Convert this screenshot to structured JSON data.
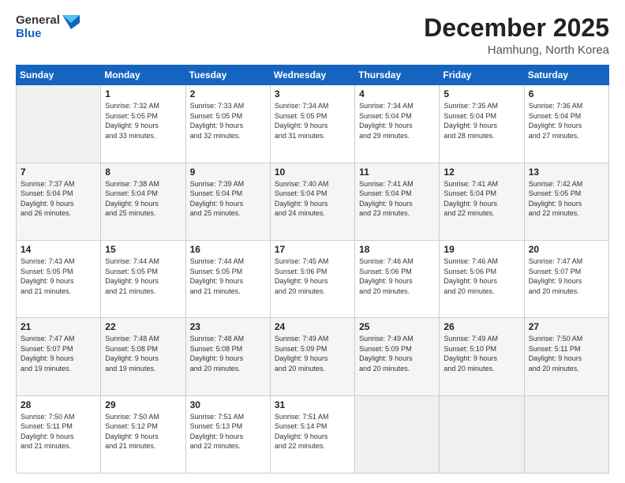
{
  "header": {
    "logo_general": "General",
    "logo_blue": "Blue",
    "month_title": "December 2025",
    "location": "Hamhung, North Korea"
  },
  "weekdays": [
    "Sunday",
    "Monday",
    "Tuesday",
    "Wednesday",
    "Thursday",
    "Friday",
    "Saturday"
  ],
  "weeks": [
    [
      {
        "day": "",
        "info": ""
      },
      {
        "day": "1",
        "info": "Sunrise: 7:32 AM\nSunset: 5:05 PM\nDaylight: 9 hours\nand 33 minutes."
      },
      {
        "day": "2",
        "info": "Sunrise: 7:33 AM\nSunset: 5:05 PM\nDaylight: 9 hours\nand 32 minutes."
      },
      {
        "day": "3",
        "info": "Sunrise: 7:34 AM\nSunset: 5:05 PM\nDaylight: 9 hours\nand 31 minutes."
      },
      {
        "day": "4",
        "info": "Sunrise: 7:34 AM\nSunset: 5:04 PM\nDaylight: 9 hours\nand 29 minutes."
      },
      {
        "day": "5",
        "info": "Sunrise: 7:35 AM\nSunset: 5:04 PM\nDaylight: 9 hours\nand 28 minutes."
      },
      {
        "day": "6",
        "info": "Sunrise: 7:36 AM\nSunset: 5:04 PM\nDaylight: 9 hours\nand 27 minutes."
      }
    ],
    [
      {
        "day": "7",
        "info": "Sunrise: 7:37 AM\nSunset: 5:04 PM\nDaylight: 9 hours\nand 26 minutes."
      },
      {
        "day": "8",
        "info": "Sunrise: 7:38 AM\nSunset: 5:04 PM\nDaylight: 9 hours\nand 25 minutes."
      },
      {
        "day": "9",
        "info": "Sunrise: 7:39 AM\nSunset: 5:04 PM\nDaylight: 9 hours\nand 25 minutes."
      },
      {
        "day": "10",
        "info": "Sunrise: 7:40 AM\nSunset: 5:04 PM\nDaylight: 9 hours\nand 24 minutes."
      },
      {
        "day": "11",
        "info": "Sunrise: 7:41 AM\nSunset: 5:04 PM\nDaylight: 9 hours\nand 23 minutes."
      },
      {
        "day": "12",
        "info": "Sunrise: 7:41 AM\nSunset: 5:04 PM\nDaylight: 9 hours\nand 22 minutes."
      },
      {
        "day": "13",
        "info": "Sunrise: 7:42 AM\nSunset: 5:05 PM\nDaylight: 9 hours\nand 22 minutes."
      }
    ],
    [
      {
        "day": "14",
        "info": "Sunrise: 7:43 AM\nSunset: 5:05 PM\nDaylight: 9 hours\nand 21 minutes."
      },
      {
        "day": "15",
        "info": "Sunrise: 7:44 AM\nSunset: 5:05 PM\nDaylight: 9 hours\nand 21 minutes."
      },
      {
        "day": "16",
        "info": "Sunrise: 7:44 AM\nSunset: 5:05 PM\nDaylight: 9 hours\nand 21 minutes."
      },
      {
        "day": "17",
        "info": "Sunrise: 7:45 AM\nSunset: 5:06 PM\nDaylight: 9 hours\nand 20 minutes."
      },
      {
        "day": "18",
        "info": "Sunrise: 7:46 AM\nSunset: 5:06 PM\nDaylight: 9 hours\nand 20 minutes."
      },
      {
        "day": "19",
        "info": "Sunrise: 7:46 AM\nSunset: 5:06 PM\nDaylight: 9 hours\nand 20 minutes."
      },
      {
        "day": "20",
        "info": "Sunrise: 7:47 AM\nSunset: 5:07 PM\nDaylight: 9 hours\nand 20 minutes."
      }
    ],
    [
      {
        "day": "21",
        "info": "Sunrise: 7:47 AM\nSunset: 5:07 PM\nDaylight: 9 hours\nand 19 minutes."
      },
      {
        "day": "22",
        "info": "Sunrise: 7:48 AM\nSunset: 5:08 PM\nDaylight: 9 hours\nand 19 minutes."
      },
      {
        "day": "23",
        "info": "Sunrise: 7:48 AM\nSunset: 5:08 PM\nDaylight: 9 hours\nand 20 minutes."
      },
      {
        "day": "24",
        "info": "Sunrise: 7:49 AM\nSunset: 5:09 PM\nDaylight: 9 hours\nand 20 minutes."
      },
      {
        "day": "25",
        "info": "Sunrise: 7:49 AM\nSunset: 5:09 PM\nDaylight: 9 hours\nand 20 minutes."
      },
      {
        "day": "26",
        "info": "Sunrise: 7:49 AM\nSunset: 5:10 PM\nDaylight: 9 hours\nand 20 minutes."
      },
      {
        "day": "27",
        "info": "Sunrise: 7:50 AM\nSunset: 5:11 PM\nDaylight: 9 hours\nand 20 minutes."
      }
    ],
    [
      {
        "day": "28",
        "info": "Sunrise: 7:50 AM\nSunset: 5:11 PM\nDaylight: 9 hours\nand 21 minutes."
      },
      {
        "day": "29",
        "info": "Sunrise: 7:50 AM\nSunset: 5:12 PM\nDaylight: 9 hours\nand 21 minutes."
      },
      {
        "day": "30",
        "info": "Sunrise: 7:51 AM\nSunset: 5:13 PM\nDaylight: 9 hours\nand 22 minutes."
      },
      {
        "day": "31",
        "info": "Sunrise: 7:51 AM\nSunset: 5:14 PM\nDaylight: 9 hours\nand 22 minutes."
      },
      {
        "day": "",
        "info": ""
      },
      {
        "day": "",
        "info": ""
      },
      {
        "day": "",
        "info": ""
      }
    ]
  ]
}
